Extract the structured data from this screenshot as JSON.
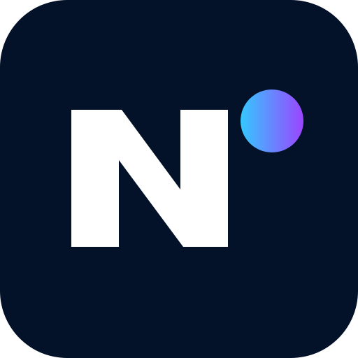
{
  "app_icon": {
    "name": "app-icon",
    "glyph": "N",
    "colors": {
      "background": "#031228",
      "glyph": "#ffffff",
      "dot_gradient_start": "#34C8FF",
      "dot_gradient_end": "#9B45FF"
    },
    "icons": [
      "letter-n-logo-icon",
      "gradient-dot-icon"
    ]
  }
}
